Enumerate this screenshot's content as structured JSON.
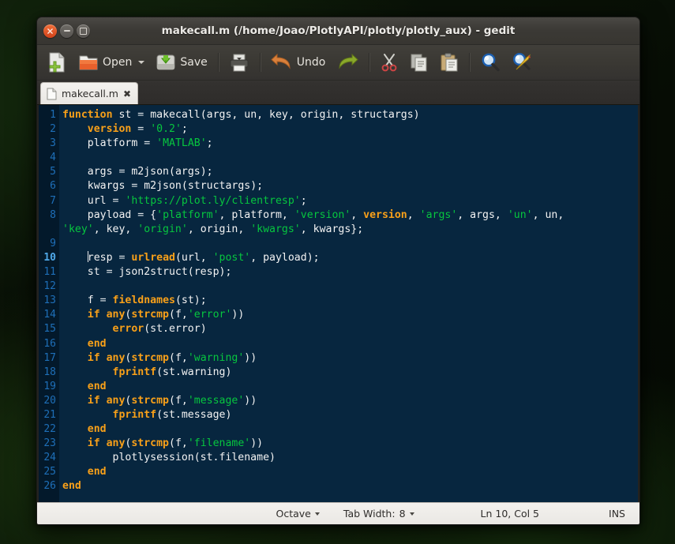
{
  "window": {
    "title": "makecall.m (/home/Joao/PlotlyAPI/plotly/plotly_aux) - gedit",
    "close_glyph": "✕",
    "accent_orange": "#f8a019",
    "accent_green": "#07c63f",
    "editor_bg": "#07263f",
    "gutter_bg": "#03192b",
    "linenum_color": "#1e6fb8"
  },
  "toolbar": {
    "items": [
      {
        "name": "new-document-button",
        "label": ""
      },
      {
        "name": "open-button",
        "label": "Open"
      },
      {
        "name": "save-button",
        "label": "Save"
      },
      {
        "name": "print-button",
        "label": ""
      },
      {
        "name": "undo-button",
        "label": "Undo"
      },
      {
        "name": "redo-button",
        "label": ""
      },
      {
        "name": "cut-button",
        "label": ""
      },
      {
        "name": "copy-button",
        "label": ""
      },
      {
        "name": "paste-button",
        "label": ""
      },
      {
        "name": "find-button",
        "label": ""
      },
      {
        "name": "replace-button",
        "label": ""
      }
    ],
    "open_label": "Open",
    "save_label": "Save",
    "undo_label": "Undo"
  },
  "tabs": [
    {
      "label": "makecall.m",
      "close": "✖",
      "active": true
    }
  ],
  "editor": {
    "language": "Octave",
    "line_numbers": [
      1,
      2,
      3,
      4,
      5,
      6,
      7,
      8,
      "",
      9,
      10,
      11,
      12,
      13,
      14,
      15,
      16,
      17,
      18,
      19,
      20,
      21,
      22,
      23,
      24,
      25,
      26
    ],
    "current_line": 10,
    "lines": [
      {
        "n": 1,
        "tokens": [
          {
            "t": "kw",
            "v": "function"
          },
          {
            "t": "pl",
            "v": " st "
          },
          {
            "t": "op",
            "v": "="
          },
          {
            "t": "pl",
            "v": " makecall(args, un, key, origin, structargs)"
          }
        ]
      },
      {
        "n": 2,
        "tokens": [
          {
            "t": "pl",
            "v": "    "
          },
          {
            "t": "kw",
            "v": "version"
          },
          {
            "t": "pl",
            "v": " "
          },
          {
            "t": "op",
            "v": "="
          },
          {
            "t": "pl",
            "v": " "
          },
          {
            "t": "str",
            "v": "'0.2'"
          },
          {
            "t": "pl",
            "v": ";"
          }
        ]
      },
      {
        "n": 3,
        "tokens": [
          {
            "t": "pl",
            "v": "    platform "
          },
          {
            "t": "op",
            "v": "="
          },
          {
            "t": "pl",
            "v": " "
          },
          {
            "t": "str",
            "v": "'MATLAB'"
          },
          {
            "t": "pl",
            "v": ";"
          }
        ]
      },
      {
        "n": 4,
        "tokens": []
      },
      {
        "n": 5,
        "tokens": [
          {
            "t": "pl",
            "v": "    args "
          },
          {
            "t": "op",
            "v": "="
          },
          {
            "t": "pl",
            "v": " m2json(args);"
          }
        ]
      },
      {
        "n": 6,
        "tokens": [
          {
            "t": "pl",
            "v": "    kwargs "
          },
          {
            "t": "op",
            "v": "="
          },
          {
            "t": "pl",
            "v": " m2json(structargs);"
          }
        ]
      },
      {
        "n": 7,
        "tokens": [
          {
            "t": "pl",
            "v": "    url "
          },
          {
            "t": "op",
            "v": "="
          },
          {
            "t": "pl",
            "v": " "
          },
          {
            "t": "str",
            "v": "'https://plot.ly/clientresp'"
          },
          {
            "t": "pl",
            "v": ";"
          }
        ]
      },
      {
        "n": 8,
        "tokens": [
          {
            "t": "pl",
            "v": "    payload "
          },
          {
            "t": "op",
            "v": "="
          },
          {
            "t": "pl",
            "v": " {"
          },
          {
            "t": "str",
            "v": "'platform'"
          },
          {
            "t": "pl",
            "v": ", platform, "
          },
          {
            "t": "str",
            "v": "'version'"
          },
          {
            "t": "pl",
            "v": ", "
          },
          {
            "t": "kw",
            "v": "version"
          },
          {
            "t": "pl",
            "v": ", "
          },
          {
            "t": "str",
            "v": "'args'"
          },
          {
            "t": "pl",
            "v": ", args, "
          },
          {
            "t": "str",
            "v": "'un'"
          },
          {
            "t": "pl",
            "v": ", un,"
          }
        ],
        "wrap": [
          {
            "t": "str",
            "v": "'key'"
          },
          {
            "t": "pl",
            "v": ", key, "
          },
          {
            "t": "str",
            "v": "'origin'"
          },
          {
            "t": "pl",
            "v": ", origin, "
          },
          {
            "t": "str",
            "v": "'kwargs'"
          },
          {
            "t": "pl",
            "v": ", kwargs};"
          }
        ]
      },
      {
        "n": 9,
        "tokens": []
      },
      {
        "n": 10,
        "tokens": [
          {
            "t": "pl",
            "v": "    "
          },
          {
            "t": "cursor",
            "v": ""
          },
          {
            "t": "pl",
            "v": "resp "
          },
          {
            "t": "op",
            "v": "="
          },
          {
            "t": "pl",
            "v": " "
          },
          {
            "t": "kw",
            "v": "urlread"
          },
          {
            "t": "pl",
            "v": "(url, "
          },
          {
            "t": "str",
            "v": "'post'"
          },
          {
            "t": "pl",
            "v": ", payload);"
          }
        ]
      },
      {
        "n": 11,
        "tokens": [
          {
            "t": "pl",
            "v": "    st "
          },
          {
            "t": "op",
            "v": "="
          },
          {
            "t": "pl",
            "v": " json2struct(resp);"
          }
        ]
      },
      {
        "n": 12,
        "tokens": []
      },
      {
        "n": 13,
        "tokens": [
          {
            "t": "pl",
            "v": "    f "
          },
          {
            "t": "op",
            "v": "="
          },
          {
            "t": "pl",
            "v": " "
          },
          {
            "t": "kw",
            "v": "fieldnames"
          },
          {
            "t": "pl",
            "v": "(st);"
          }
        ]
      },
      {
        "n": 14,
        "tokens": [
          {
            "t": "pl",
            "v": "    "
          },
          {
            "t": "kw",
            "v": "if any"
          },
          {
            "t": "pl",
            "v": "("
          },
          {
            "t": "kw",
            "v": "strcmp"
          },
          {
            "t": "pl",
            "v": "(f,"
          },
          {
            "t": "str",
            "v": "'error'"
          },
          {
            "t": "pl",
            "v": "))"
          }
        ]
      },
      {
        "n": 15,
        "tokens": [
          {
            "t": "pl",
            "v": "        "
          },
          {
            "t": "kw",
            "v": "error"
          },
          {
            "t": "pl",
            "v": "(st.error)"
          }
        ]
      },
      {
        "n": 16,
        "tokens": [
          {
            "t": "pl",
            "v": "    "
          },
          {
            "t": "kw",
            "v": "end"
          }
        ]
      },
      {
        "n": 17,
        "tokens": [
          {
            "t": "pl",
            "v": "    "
          },
          {
            "t": "kw",
            "v": "if any"
          },
          {
            "t": "pl",
            "v": "("
          },
          {
            "t": "kw",
            "v": "strcmp"
          },
          {
            "t": "pl",
            "v": "(f,"
          },
          {
            "t": "str",
            "v": "'warning'"
          },
          {
            "t": "pl",
            "v": "))"
          }
        ]
      },
      {
        "n": 18,
        "tokens": [
          {
            "t": "pl",
            "v": "        "
          },
          {
            "t": "kw",
            "v": "fprintf"
          },
          {
            "t": "pl",
            "v": "(st.warning)"
          }
        ]
      },
      {
        "n": 19,
        "tokens": [
          {
            "t": "pl",
            "v": "    "
          },
          {
            "t": "kw",
            "v": "end"
          }
        ]
      },
      {
        "n": 20,
        "tokens": [
          {
            "t": "pl",
            "v": "    "
          },
          {
            "t": "kw",
            "v": "if any"
          },
          {
            "t": "pl",
            "v": "("
          },
          {
            "t": "kw",
            "v": "strcmp"
          },
          {
            "t": "pl",
            "v": "(f,"
          },
          {
            "t": "str",
            "v": "'message'"
          },
          {
            "t": "pl",
            "v": "))"
          }
        ]
      },
      {
        "n": 21,
        "tokens": [
          {
            "t": "pl",
            "v": "        "
          },
          {
            "t": "kw",
            "v": "fprintf"
          },
          {
            "t": "pl",
            "v": "(st.message)"
          }
        ]
      },
      {
        "n": 22,
        "tokens": [
          {
            "t": "pl",
            "v": "    "
          },
          {
            "t": "kw",
            "v": "end"
          }
        ]
      },
      {
        "n": 23,
        "tokens": [
          {
            "t": "pl",
            "v": "    "
          },
          {
            "t": "kw",
            "v": "if any"
          },
          {
            "t": "pl",
            "v": "("
          },
          {
            "t": "kw",
            "v": "strcmp"
          },
          {
            "t": "pl",
            "v": "(f,"
          },
          {
            "t": "str",
            "v": "'filename'"
          },
          {
            "t": "pl",
            "v": "))"
          }
        ]
      },
      {
        "n": 24,
        "tokens": [
          {
            "t": "pl",
            "v": "        plotlysession(st.filename)"
          }
        ]
      },
      {
        "n": 25,
        "tokens": [
          {
            "t": "pl",
            "v": "    "
          },
          {
            "t": "kw",
            "v": "end"
          }
        ]
      },
      {
        "n": 26,
        "tokens": [
          {
            "t": "kw",
            "v": "end"
          }
        ]
      }
    ]
  },
  "statusbar": {
    "language": "Octave",
    "tab_width_label": "Tab Width:",
    "tab_width_value": "8",
    "position": "Ln 10, Col 5",
    "insert_mode": "INS"
  }
}
